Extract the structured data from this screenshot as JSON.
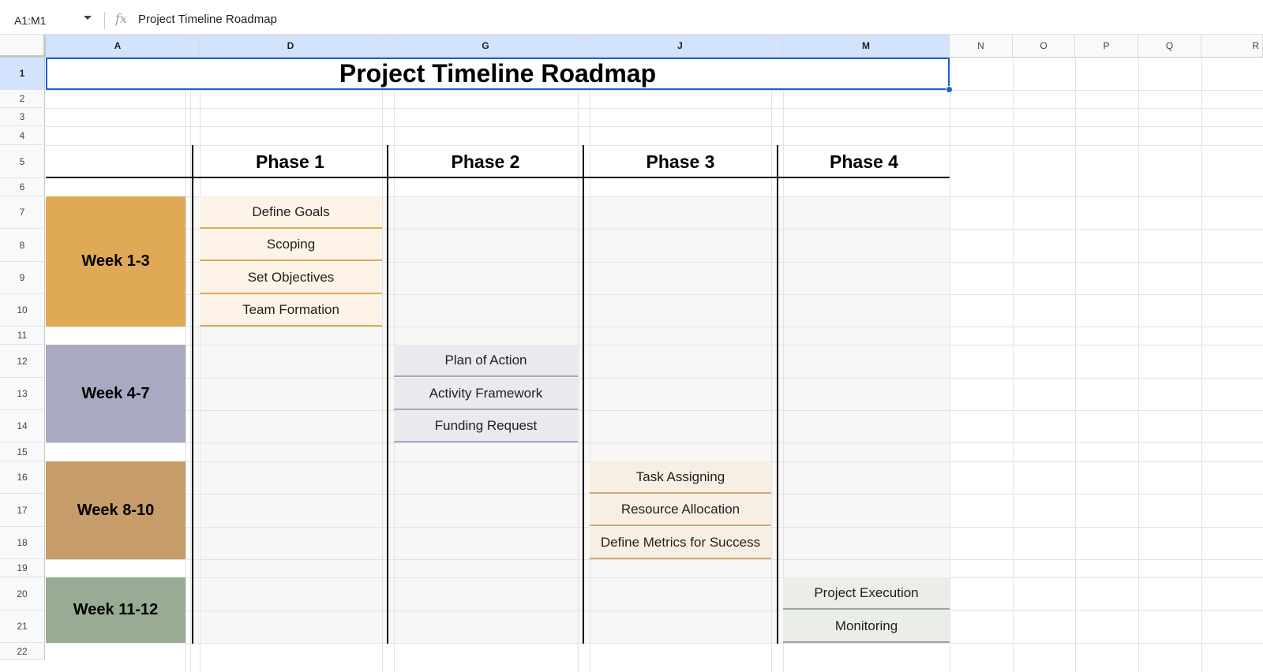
{
  "formula_bar": {
    "name_box": "A1:M1",
    "fx_icon": "fx",
    "formula": "Project Timeline Roadmap"
  },
  "columns": [
    "A",
    "D",
    "G",
    "J",
    "M",
    "N",
    "O",
    "P",
    "Q",
    "R"
  ],
  "rows": [
    "1",
    "2",
    "3",
    "4",
    "5",
    "6",
    "7",
    "8",
    "9",
    "10",
    "11",
    "12",
    "13",
    "14",
    "15",
    "16",
    "17",
    "18",
    "19",
    "20",
    "21",
    "22"
  ],
  "sheet": {
    "title": "Project Timeline Roadmap",
    "phases": [
      "Phase 1",
      "Phase 2",
      "Phase 3",
      "Phase 4"
    ],
    "weeks": [
      {
        "label": "Week 1-3",
        "color": "#e0a956"
      },
      {
        "label": "Week 4-7",
        "color": "#a9a9c2"
      },
      {
        "label": "Week 8-10",
        "color": "#c69c6a"
      },
      {
        "label": "Week 11-12",
        "color": "#9aab94"
      }
    ],
    "tasks": {
      "phase1": [
        "Define Goals",
        "Scoping",
        "Set Objectives",
        "Team Formation"
      ],
      "phase2": [
        "Plan of Action",
        "Activity Framework",
        "Funding Request"
      ],
      "phase3": [
        "Task Assigning",
        "Resource Allocation",
        "Define Metrics for Success"
      ],
      "phase4": [
        "Project Execution",
        "Monitoring"
      ]
    }
  },
  "colors": {
    "selection": "#1a5fd6",
    "header_selected": "#d3e3fd"
  }
}
